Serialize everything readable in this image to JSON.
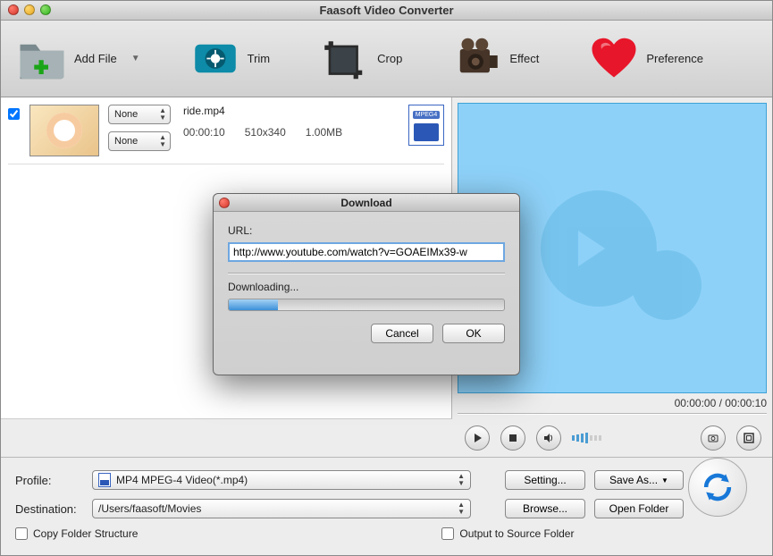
{
  "window": {
    "title": "Faasoft Video Converter"
  },
  "toolbar": {
    "add_file": "Add File",
    "trim": "Trim",
    "crop": "Crop",
    "effect": "Effect",
    "preference": "Preference"
  },
  "file": {
    "select_a": "None",
    "select_b": "None",
    "name": "ride.mp4",
    "duration": "00:00:10",
    "resolution": "510x340",
    "size": "1.00MB",
    "format_tag": "MPEG4"
  },
  "preview": {
    "timecode": "00:00:00 / 00:00:10"
  },
  "dialog": {
    "title": "Download",
    "url_label": "URL:",
    "url_value": "http://www.youtube.com/watch?v=GOAEIMx39-w",
    "status": "Downloading...",
    "cancel": "Cancel",
    "ok": "OK"
  },
  "bottom": {
    "profile_label": "Profile:",
    "profile_value": "MP4 MPEG-4 Video(*.mp4)",
    "destination_label": "Destination:",
    "destination_value": "/Users/faasoft/Movies",
    "setting": "Setting...",
    "browse": "Browse...",
    "save_as": "Save As...",
    "open_folder": "Open Folder",
    "copy_structure": "Copy Folder Structure",
    "output_source": "Output to Source Folder"
  }
}
